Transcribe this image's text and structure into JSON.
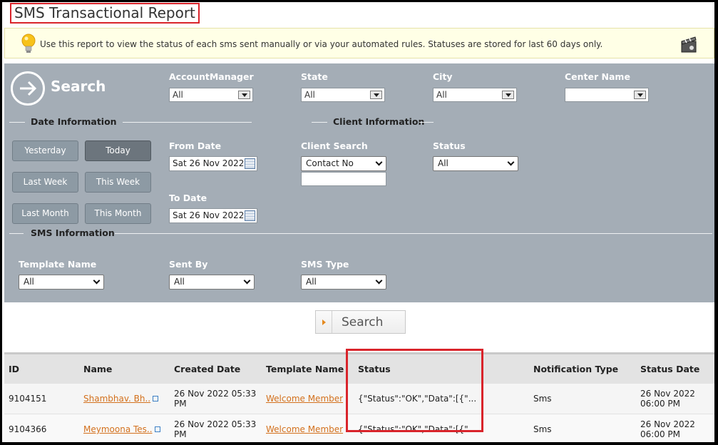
{
  "page": {
    "title": "SMS Transactional Report",
    "info": "Use this report to view the status of each sms sent manually or via your automated rules. Statuses are stored for last 60 days only."
  },
  "search_panel": {
    "search_label": "Search",
    "account_manager": {
      "label": "AccountManager",
      "value": "All"
    },
    "state": {
      "label": "State",
      "value": "All"
    },
    "city": {
      "label": "City",
      "value": "All"
    },
    "center_name": {
      "label": "Center Name",
      "value": ""
    },
    "date_section": "Date Information",
    "client_section": "Client Information",
    "sms_section": "SMS Information",
    "date_buttons": {
      "yesterday": "Yesterday",
      "today": "Today",
      "last_week": "Last Week",
      "this_week": "This Week",
      "last_month": "Last Month",
      "this_month": "This Month"
    },
    "from_date": {
      "label": "From Date",
      "value": "Sat 26 Nov 2022"
    },
    "to_date": {
      "label": "To Date",
      "value": "Sat 26 Nov 2022"
    },
    "client_search": {
      "label": "Client Search",
      "value": "Contact No",
      "text": ""
    },
    "status": {
      "label": "Status",
      "value": "All"
    },
    "template_name": {
      "label": "Template Name",
      "value": "All"
    },
    "sent_by": {
      "label": "Sent By",
      "value": "All"
    },
    "sms_type": {
      "label": "SMS Type",
      "value": "All"
    },
    "search_button": "Search"
  },
  "table": {
    "headers": {
      "id": "ID",
      "name": "Name",
      "created": "Created Date",
      "template": "Template Name",
      "status": "Status",
      "notification": "Notification Type",
      "status_date": "Status Date"
    },
    "rows": [
      {
        "id": "9104151",
        "name": "Shambhav. Bh..",
        "created": "26 Nov 2022 05:33 PM",
        "template": "Welcome Member",
        "status": "{\"Status\":\"OK\",\"Data\":[{\"...",
        "notification": "Sms",
        "status_date": "26 Nov 2022 06:00 PM"
      },
      {
        "id": "9104366",
        "name": "Meymoona Tes..",
        "created": "26 Nov 2022 05:33 PM",
        "template": "Welcome Member",
        "status": "{\"Status\":\"OK\",\"Data\":[{\"...",
        "notification": "Sms",
        "status_date": "26 Nov 2022 06:00 PM"
      }
    ]
  },
  "colors": {
    "panel": "#a4adb6",
    "highlight": "#d9242b",
    "link": "#d3701c"
  }
}
